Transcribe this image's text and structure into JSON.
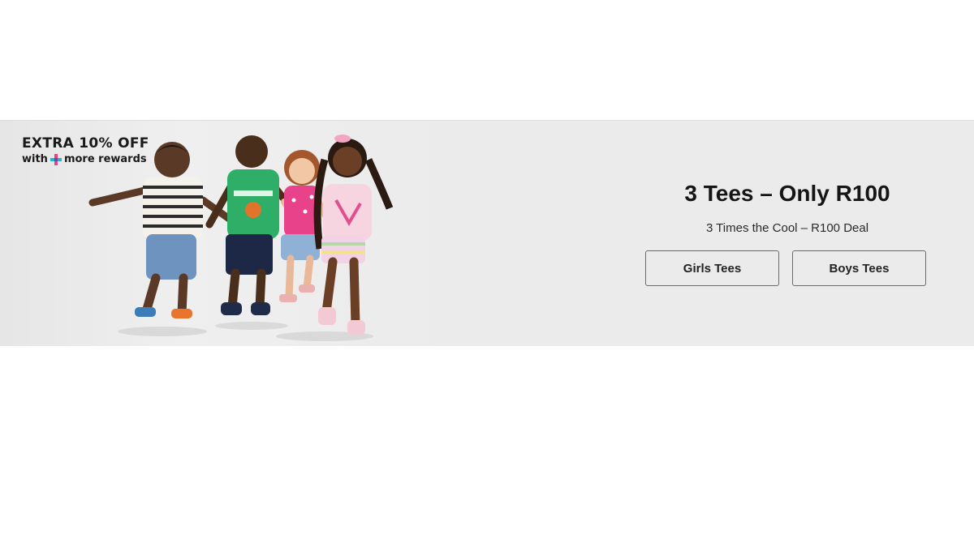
{
  "promo_badge": {
    "title": "EXTRA 10% OFF",
    "subtitle_prefix": "with",
    "subtitle_suffix": "more rewards",
    "logo_icon": "plus-logo-icon",
    "logo_colors": [
      "#e9418c",
      "#21b7c9",
      "#6b4aa0"
    ]
  },
  "hero_image": {
    "description_icon": "kids-running-photo"
  },
  "offer": {
    "headline": "3 Tees – Only R100",
    "subline": "3 Times the Cool – R100 Deal"
  },
  "buttons": {
    "girls_label": "Girls Tees",
    "boys_label": "Boys Tees"
  },
  "colors": {
    "banner_bg": "#ebebeb",
    "text": "#151515",
    "button_border": "#6b6b6b"
  }
}
